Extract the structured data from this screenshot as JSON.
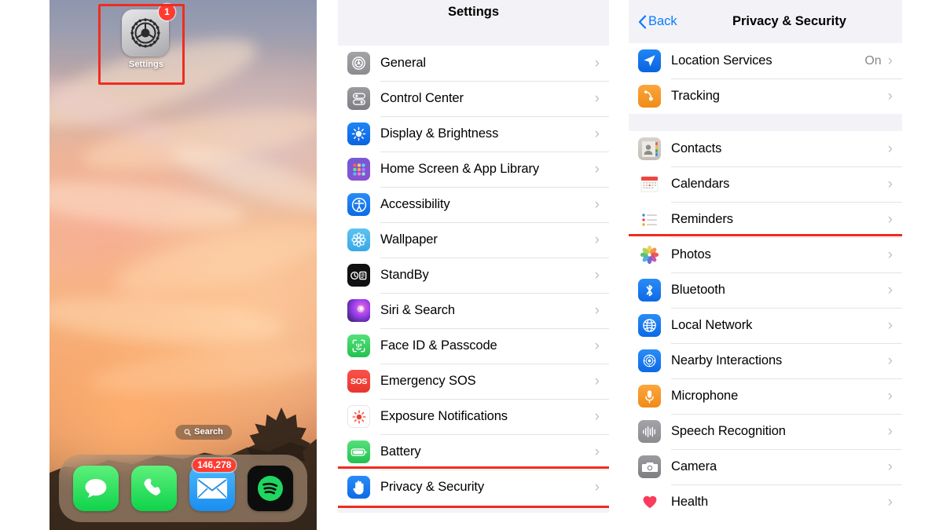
{
  "home_screen": {
    "app": {
      "name": "Settings",
      "icon": "settings-gear-icon",
      "badge": "1"
    },
    "search_pill": {
      "label": "Search",
      "icon": "search-icon"
    },
    "dock": [
      {
        "name": "Messages",
        "icon": "messages-icon",
        "badge": ""
      },
      {
        "name": "Phone",
        "icon": "phone-icon",
        "badge": ""
      },
      {
        "name": "Mail",
        "icon": "mail-icon",
        "badge": "146,278"
      },
      {
        "name": "Spotify",
        "icon": "spotify-icon",
        "badge": ""
      }
    ],
    "highlight_color": "#ee2d20"
  },
  "settings_panel": {
    "title": "Settings",
    "items": [
      {
        "label": "General",
        "icon": "gear-icon",
        "highlighted": false
      },
      {
        "label": "Control Center",
        "icon": "control-center-icon",
        "highlighted": false
      },
      {
        "label": "Display & Brightness",
        "icon": "brightness-icon",
        "highlighted": false
      },
      {
        "label": "Home Screen & App Library",
        "icon": "home-screen-icon",
        "highlighted": false
      },
      {
        "label": "Accessibility",
        "icon": "accessibility-icon",
        "highlighted": false
      },
      {
        "label": "Wallpaper",
        "icon": "wallpaper-icon",
        "highlighted": false
      },
      {
        "label": "StandBy",
        "icon": "standby-icon",
        "highlighted": false
      },
      {
        "label": "Siri & Search",
        "icon": "siri-icon",
        "highlighted": false
      },
      {
        "label": "Face ID & Passcode",
        "icon": "face-id-icon",
        "highlighted": false
      },
      {
        "label": "Emergency SOS",
        "icon": "sos-icon",
        "highlighted": false
      },
      {
        "label": "Exposure Notifications",
        "icon": "exposure-icon",
        "highlighted": false
      },
      {
        "label": "Battery",
        "icon": "battery-icon",
        "highlighted": false
      },
      {
        "label": "Privacy & Security",
        "icon": "privacy-hand-icon",
        "highlighted": true
      }
    ]
  },
  "privacy_panel": {
    "back_label": "Back",
    "title": "Privacy & Security",
    "section_1": [
      {
        "label": "Location Services",
        "icon": "location-arrow-icon",
        "value": "On"
      },
      {
        "label": "Tracking",
        "icon": "tracking-icon",
        "value": ""
      }
    ],
    "section_2": [
      {
        "label": "Contacts",
        "icon": "contacts-icon",
        "highlighted": false
      },
      {
        "label": "Calendars",
        "icon": "calendar-icon",
        "highlighted": false
      },
      {
        "label": "Reminders",
        "icon": "reminders-icon",
        "highlighted": false
      },
      {
        "label": "Photos",
        "icon": "photos-icon",
        "highlighted": true
      },
      {
        "label": "Bluetooth",
        "icon": "bluetooth-icon",
        "highlighted": false
      },
      {
        "label": "Local Network",
        "icon": "globe-icon",
        "highlighted": false
      },
      {
        "label": "Nearby Interactions",
        "icon": "nearby-icon",
        "highlighted": false
      },
      {
        "label": "Microphone",
        "icon": "microphone-icon",
        "highlighted": false
      },
      {
        "label": "Speech Recognition",
        "icon": "waveform-icon",
        "highlighted": false
      },
      {
        "label": "Camera",
        "icon": "camera-icon",
        "highlighted": false
      },
      {
        "label": "Health",
        "icon": "heart-icon",
        "highlighted": false
      }
    ]
  }
}
